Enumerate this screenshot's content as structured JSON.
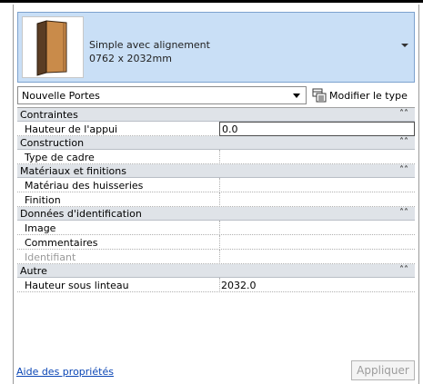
{
  "type_selector": {
    "family_name": "Simple avec alignement",
    "size": "0762 x 2032mm"
  },
  "family_selector": {
    "value": "Nouvelle Portes",
    "edit_type_label": "Modifier le type"
  },
  "properties": {
    "constraints": {
      "title": "Contraintes",
      "sill_height_label": "Hauteur de l'appui",
      "sill_height_value": "0.0"
    },
    "construction": {
      "title": "Construction",
      "frame_type_label": "Type de cadre"
    },
    "materials": {
      "title": "Matériaux et finitions",
      "frame_material_label": "Matériau des huisseries",
      "finish_label": "Finition"
    },
    "identity": {
      "title": "Données d'identification",
      "image_label": "Image",
      "comments_label": "Commentaires",
      "mark_label": "Identifiant"
    },
    "other": {
      "title": "Autre",
      "head_height_label": "Hauteur sous linteau",
      "head_height_value": "2032.0"
    }
  },
  "footer": {
    "help_link": "Aide des propriétés",
    "apply_label": "Appliquer"
  }
}
